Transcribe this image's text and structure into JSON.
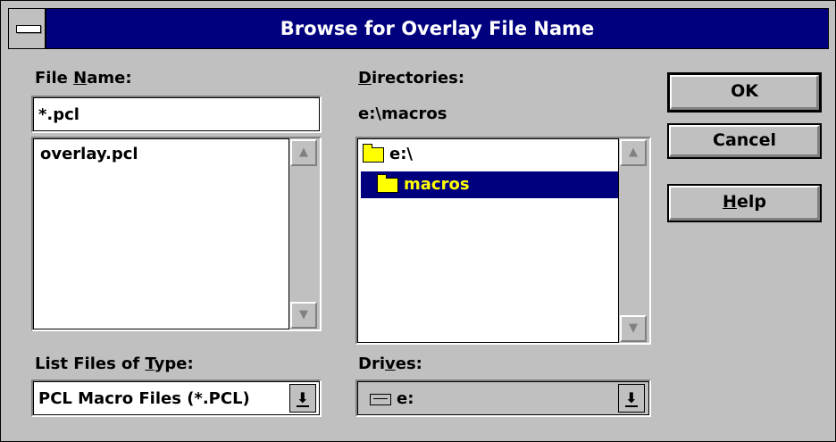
{
  "window": {
    "title": "Browse for Overlay File Name"
  },
  "file_name": {
    "label_pre": "File ",
    "label_u": "N",
    "label_post": "ame:",
    "value": "*.pcl",
    "files": [
      "overlay.pcl"
    ]
  },
  "directories": {
    "label_u": "D",
    "label_post": "irectories:",
    "current_path": "e:\\macros",
    "items": [
      {
        "name": "e:\\",
        "icon": "open-folder-icon"
      },
      {
        "name": "macros",
        "icon": "open-folder-icon",
        "selected": true
      }
    ]
  },
  "buttons": {
    "ok": "OK",
    "cancel": "Cancel",
    "help_u": "H",
    "help_post": "elp"
  },
  "file_type": {
    "label_pre": "List Files of ",
    "label_u": "T",
    "label_post": "ype:",
    "value": "PCL Macro Files (*.PCL)"
  },
  "drives": {
    "label_pre": "Dri",
    "label_u": "v",
    "label_post": "es:",
    "value": "e:",
    "icon": "drive-icon"
  },
  "colors": {
    "titlebar": "#00007f",
    "selection": "#00007f",
    "selection_text": "#ffff00",
    "face": "#c0c0c0"
  }
}
